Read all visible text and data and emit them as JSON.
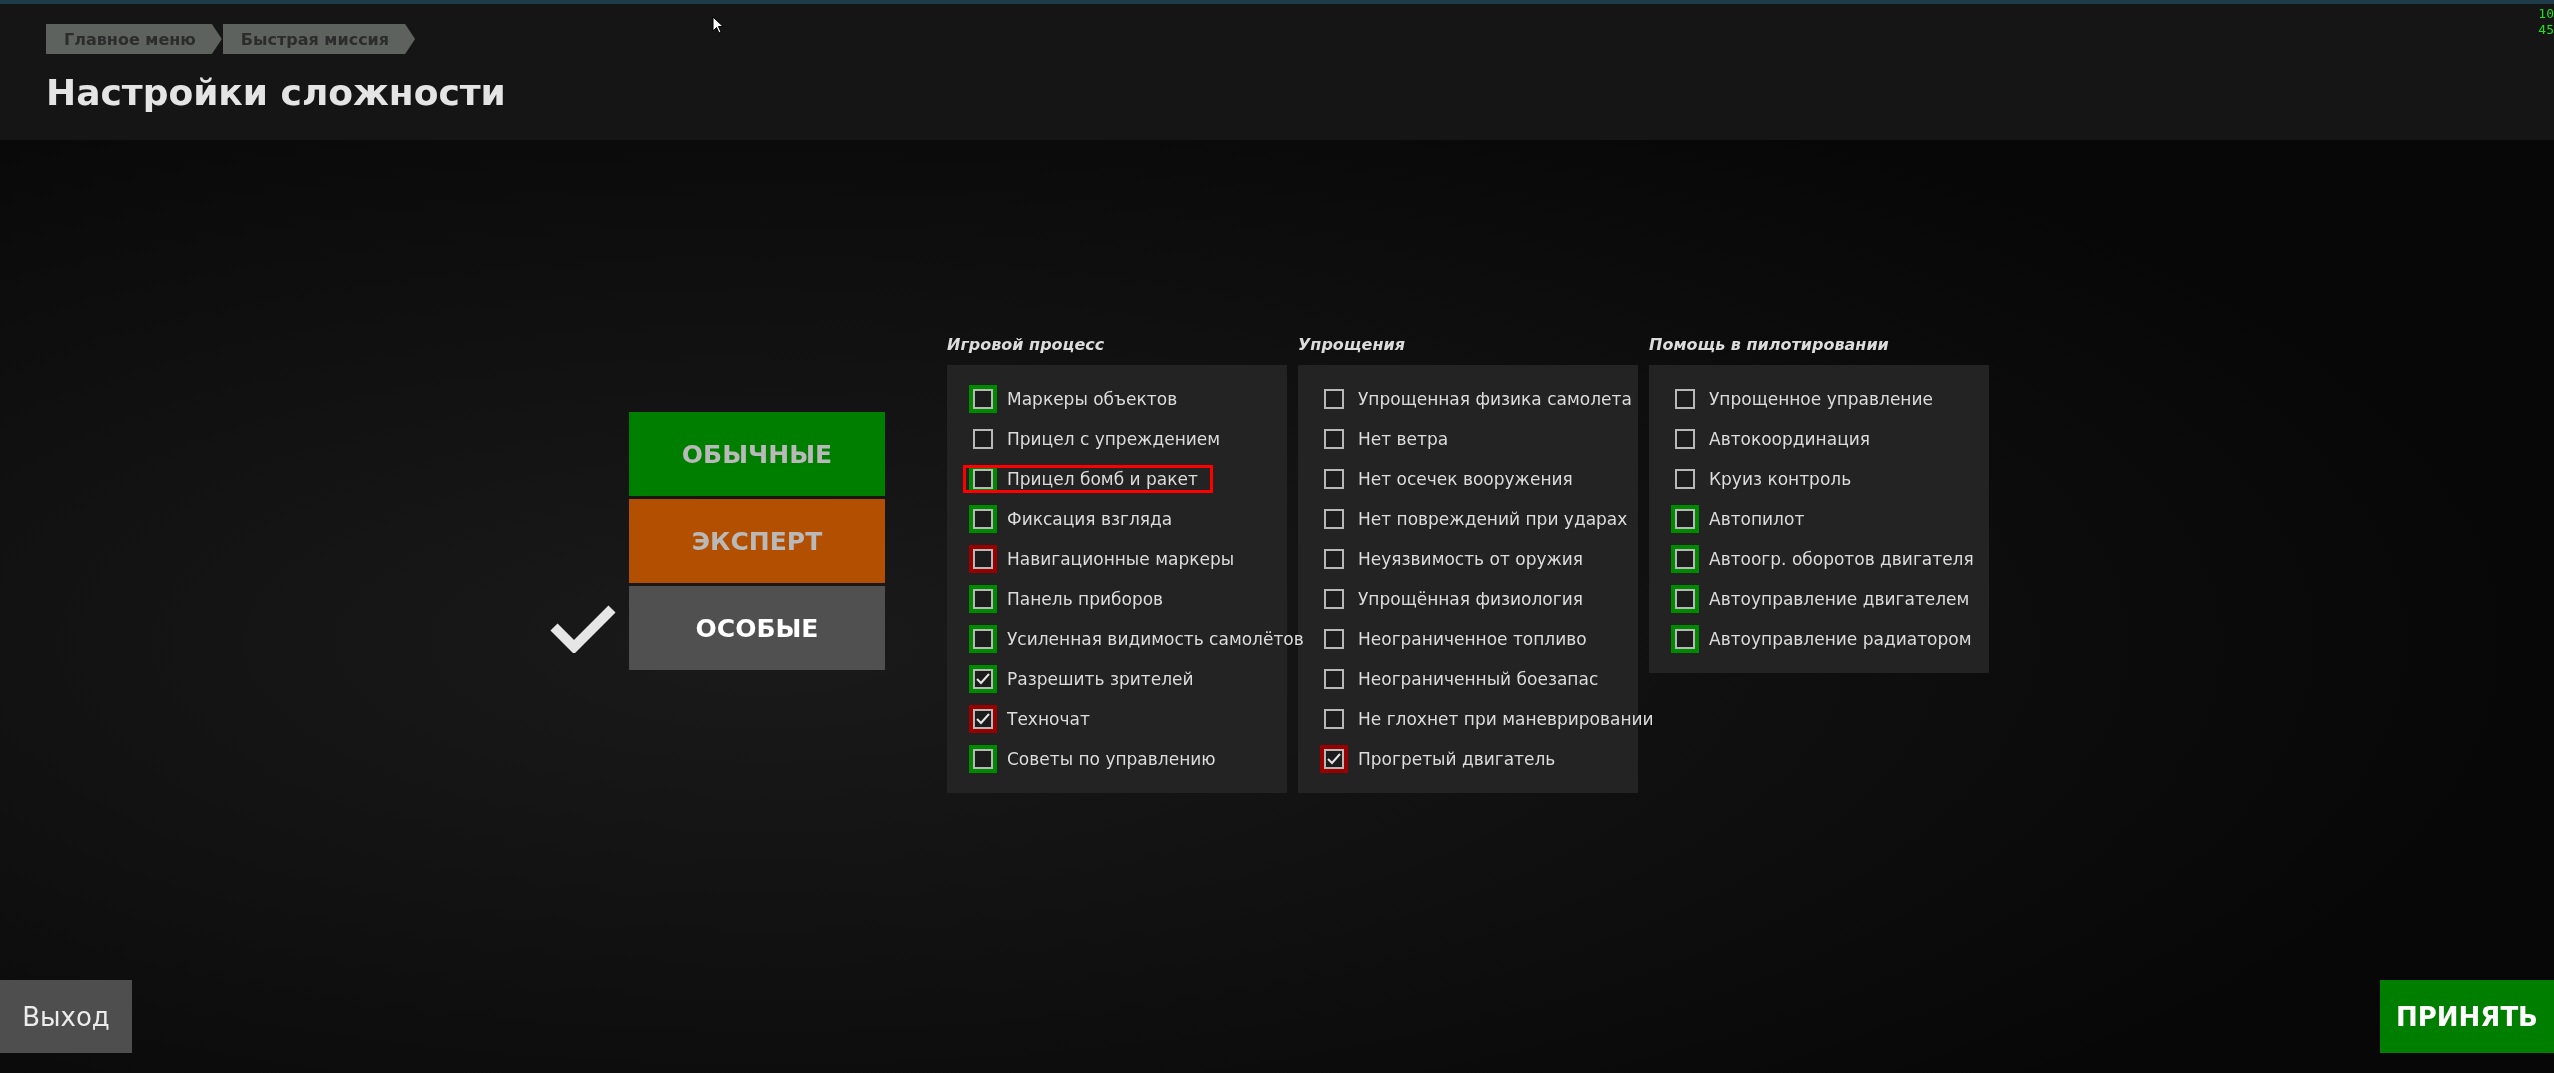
{
  "breadcrumbs": [
    "Главное меню",
    "Быстрая миссия"
  ],
  "title": "Настройки сложности",
  "counter": [
    "10",
    "45"
  ],
  "presets": [
    {
      "label": "ОБЫЧНЫЕ",
      "kind": "normal",
      "selected": false
    },
    {
      "label": "ЭКСПЕРТ",
      "kind": "expert",
      "selected": false
    },
    {
      "label": "ОСОБЫЕ",
      "kind": "custom",
      "selected": true
    }
  ],
  "groups": [
    {
      "title": "Игровой процесс",
      "items": [
        {
          "label": "Маркеры объектов",
          "checked": false,
          "color": "#008a00",
          "annotated": false
        },
        {
          "label": "Прицел с упреждением",
          "checked": false,
          "annotated": false
        },
        {
          "label": "Прицел бомб и ракет",
          "checked": false,
          "color": "#008a00",
          "annotated": true
        },
        {
          "label": "Фиксация взгляда",
          "checked": false,
          "color": "#008a00",
          "annotated": false
        },
        {
          "label": "Навигационные маркеры",
          "checked": false,
          "color": "#9a0000",
          "annotated": false
        },
        {
          "label": "Панель приборов",
          "checked": false,
          "color": "#008a00",
          "annotated": false
        },
        {
          "label": "Усиленная видимость самолётов",
          "checked": false,
          "color": "#008a00",
          "annotated": false
        },
        {
          "label": "Разрешить зрителей",
          "checked": true,
          "color": "#008a00",
          "annotated": false
        },
        {
          "label": "Техночат",
          "checked": true,
          "color": "#9a0000",
          "annotated": false
        },
        {
          "label": "Советы по управлению",
          "checked": false,
          "color": "#008a00",
          "annotated": false
        }
      ]
    },
    {
      "title": "Упрощения",
      "items": [
        {
          "label": "Упрощенная физика самолета",
          "checked": false,
          "annotated": false
        },
        {
          "label": "Нет ветра",
          "checked": false,
          "annotated": false
        },
        {
          "label": "Нет осечек вооружения",
          "checked": false,
          "annotated": false
        },
        {
          "label": "Нет повреждений при ударах",
          "checked": false,
          "annotated": false
        },
        {
          "label": "Неуязвимость от оружия",
          "checked": false,
          "annotated": false
        },
        {
          "label": "Упрощённая физиология",
          "checked": false,
          "annotated": false
        },
        {
          "label": "Неограниченное топливо",
          "checked": false,
          "annotated": false
        },
        {
          "label": "Неограниченный боезапас",
          "checked": false,
          "annotated": false
        },
        {
          "label": "Не глохнет при маневрировании",
          "checked": false,
          "annotated": false
        },
        {
          "label": "Прогретый двигатель",
          "checked": true,
          "color": "#9a0000",
          "annotated": false
        }
      ]
    },
    {
      "title": "Помощь в пилотировании",
      "items": [
        {
          "label": "Упрощенное управление",
          "checked": false,
          "annotated": false
        },
        {
          "label": "Автокоординация",
          "checked": false,
          "annotated": false
        },
        {
          "label": "Круиз контроль",
          "checked": false,
          "annotated": false
        },
        {
          "label": "Автопилот",
          "checked": false,
          "color": "#008a00",
          "annotated": false
        },
        {
          "label": "Автоогр. оборотов двигателя",
          "checked": false,
          "color": "#008a00",
          "annotated": false
        },
        {
          "label": "Автоуправление двигателем",
          "checked": false,
          "color": "#008a00",
          "annotated": false
        },
        {
          "label": "Автоуправление радиатором",
          "checked": false,
          "color": "#008a00",
          "annotated": false
        }
      ]
    }
  ],
  "exit_button": "Выход",
  "accept_button": "ПРИНЯТЬ"
}
